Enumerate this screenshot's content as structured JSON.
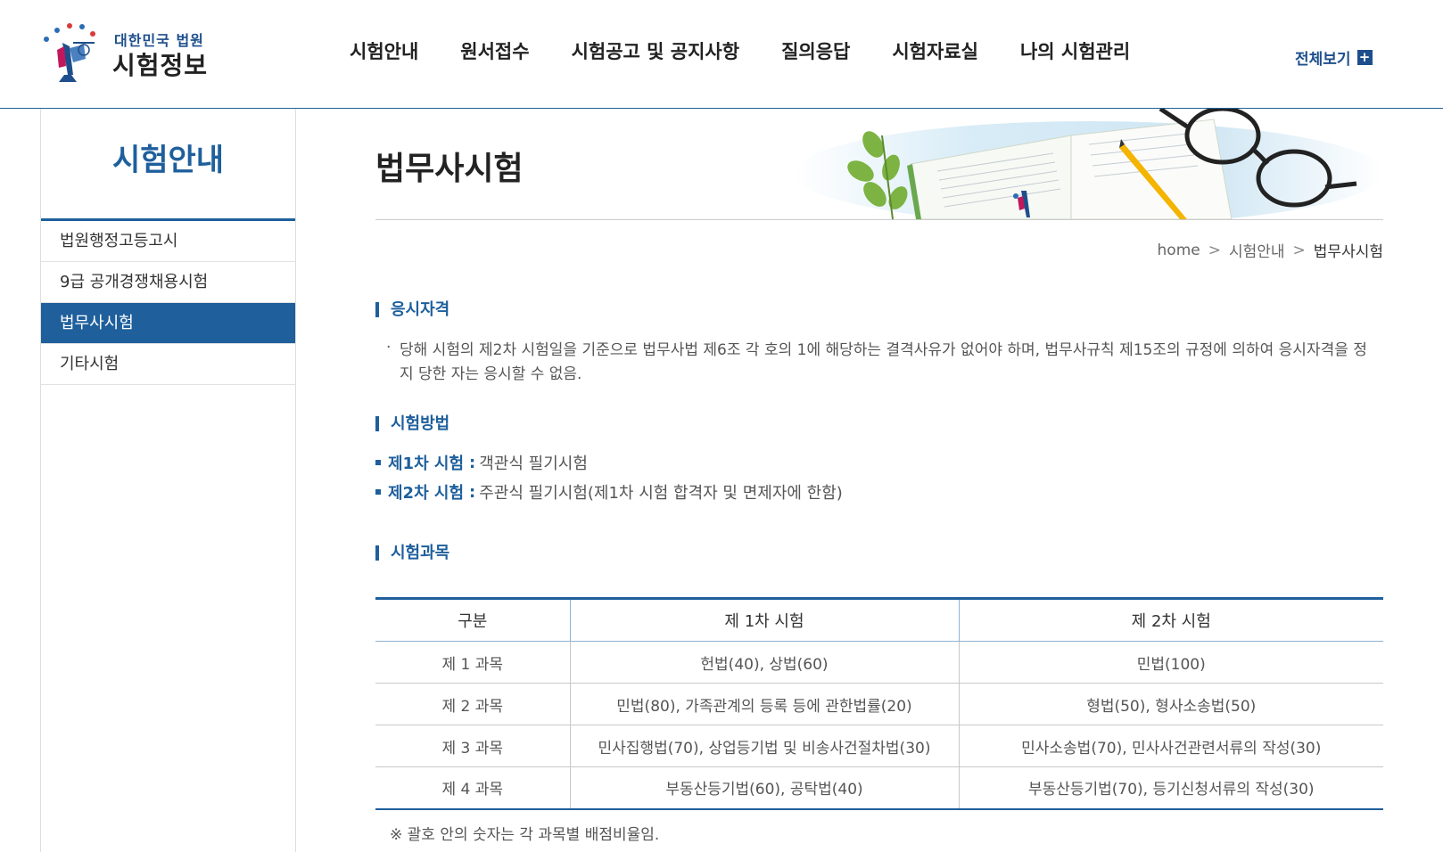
{
  "header": {
    "logo_sub": "대한민국 법원",
    "logo_main": "시험정보",
    "nav": [
      "시험안내",
      "원서접수",
      "시험공고 및 공지사항",
      "질의응답",
      "시험자료실",
      "나의 시험관리"
    ],
    "view_all": "전체보기",
    "view_all_icon": "plus-icon"
  },
  "sidebar": {
    "title": "시험안내",
    "items": [
      "법원행정고등고시",
      "9급 공개경쟁채용시험",
      "법무사시험",
      "기타시험"
    ],
    "active_index": 2
  },
  "page": {
    "title": "법무사시험",
    "breadcrumb": [
      "home",
      "시험안내",
      "법무사시험"
    ]
  },
  "qualification": {
    "heading": "응시자격",
    "bullet": "·",
    "text": "당해 시험의 제2차 시험일을 기준으로 법무사법 제6조 각 호의 1에 해당하는 결격사유가 없어야 하며, 법무사규칙 제15조의 규정에 의하여 응시자격을 정지 당한 자는 응시할 수 없음."
  },
  "method": {
    "heading": "시험방법",
    "rows": [
      {
        "label": "제1차 시험",
        "desc": "객관식 필기시험"
      },
      {
        "label": "제2차 시험",
        "desc": "주관식 필기시험(제1차 시험 합격자 및 면제자에 한함)"
      }
    ],
    "separator": ":"
  },
  "subjects": {
    "heading": "시험과목",
    "columns": [
      "구분",
      "제 1차 시험",
      "제 2차 시험"
    ],
    "rows": [
      [
        "제 1 과목",
        "헌법(40), 상법(60)",
        "민법(100)"
      ],
      [
        "제 2 과목",
        "민법(80), 가족관계의 등록 등에 관한법률(20)",
        "형법(50), 형사소송법(50)"
      ],
      [
        "제 3 과목",
        "민사집행법(70), 상업등기법 및 비송사건절차법(30)",
        "민사소송법(70), 민사사건관련서류의 작성(30)"
      ],
      [
        "제 4 과목",
        "부동산등기법(60), 공탁법(40)",
        "부동산등기법(70), 등기신청서류의 작성(30)"
      ]
    ],
    "note": "※ 괄호 안의 숫자는 각 과목별 배점비율임."
  },
  "colors": {
    "primary": "#1e5f9c",
    "logo_blue": "#1e4f8c",
    "text": "#333333"
  }
}
